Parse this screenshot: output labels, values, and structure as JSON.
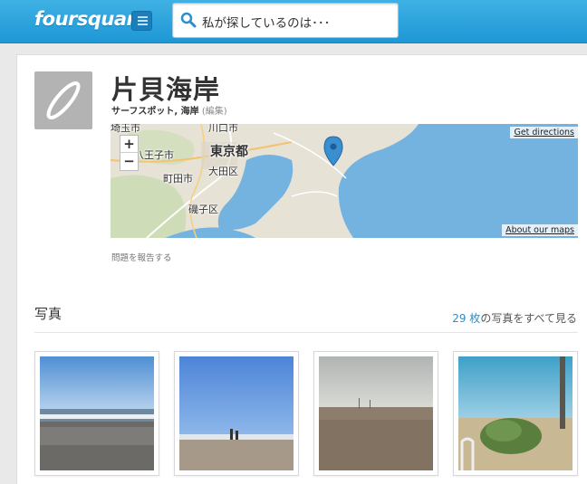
{
  "header": {
    "logo": "foursquare",
    "search_placeholder": "私が探しているのは･･･"
  },
  "venue": {
    "title": "片貝海岸",
    "categories": "サーフスポット, 海岸",
    "edit_label": "(編集)",
    "report_label": "問題を報告する"
  },
  "map": {
    "get_directions": "Get directions",
    "about_maps": "About our maps",
    "zoom_in": "+",
    "zoom_out": "−",
    "labels": {
      "kawaguchi": "川口市",
      "tokyo": "東京都",
      "hachioji": "八王子市",
      "ota": "大田区",
      "machida": "町田市",
      "isogo": "磯子区",
      "top_left": "埼玉市"
    }
  },
  "photos": {
    "title": "写真",
    "count": "29 枚",
    "see_all_suffix": "の写真をすべて見る"
  },
  "colors": {
    "header_blue": "#1e97d5",
    "link_blue": "#2d8dc4",
    "sea": "#74b3e0",
    "pin": "#3a8fd0"
  }
}
